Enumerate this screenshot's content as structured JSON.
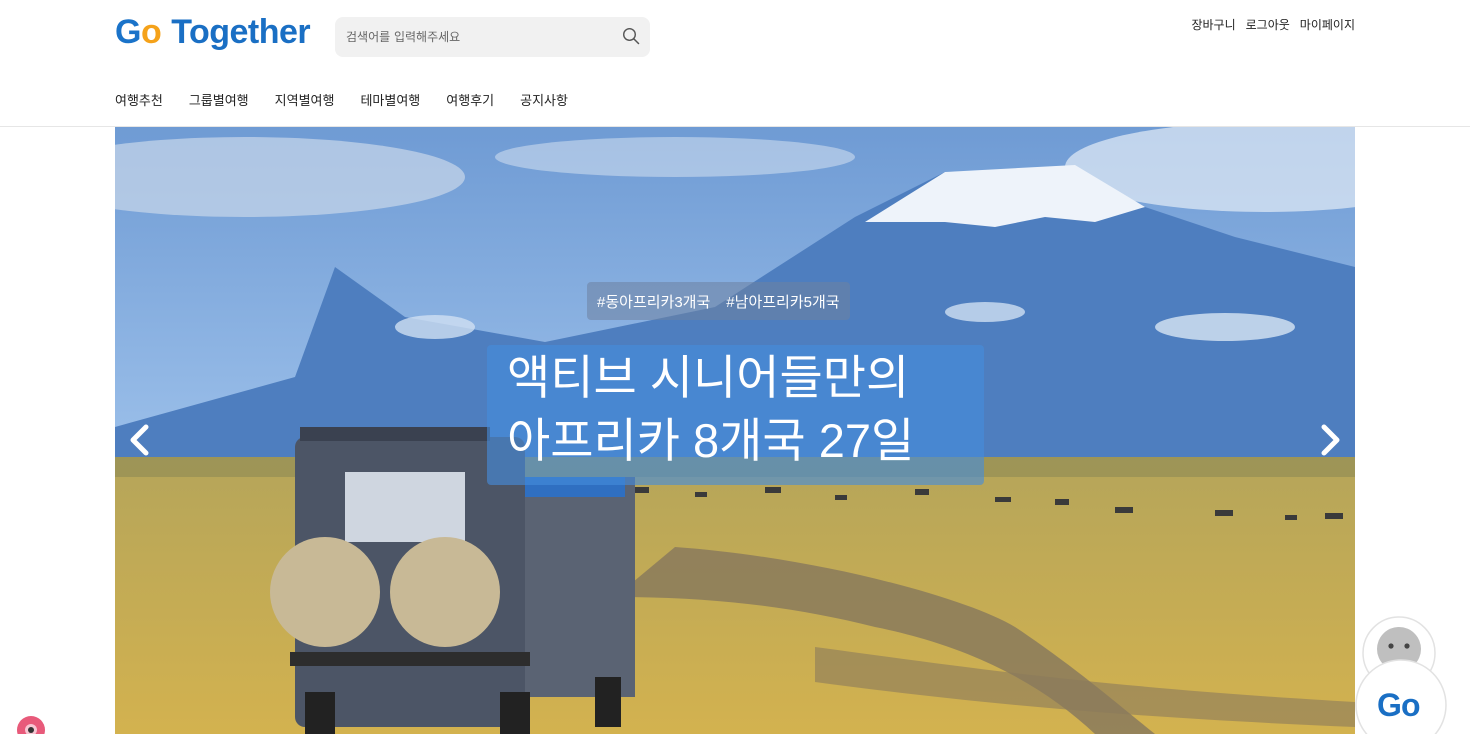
{
  "brand": {
    "logo_text_a": "G",
    "logo_text_b": "o",
    "logo_text_c": "Together",
    "color": "#1a6fc4",
    "accent": "#f5a21a"
  },
  "search": {
    "placeholder": "검색어를 입력해주세요",
    "icon": "search-icon"
  },
  "util": {
    "cart": "장바구니",
    "logout": "로그아웃",
    "mypage": "마이페이지"
  },
  "nav": [
    "여행추천",
    "그룹별여행",
    "지역별여행",
    "테마별여행",
    "여행후기",
    "공지사항"
  ],
  "hero": {
    "tags": [
      "#동아프리카3개국",
      "#남아프리카5개국"
    ],
    "headline_line1": "액티브 시니어들만의",
    "headline_line2": "아프리카 8개국 27일",
    "prev_icon": "chevron-left-icon",
    "next_icon": "chevron-right-icon"
  },
  "chatbot": {
    "label": "Go",
    "icon": "chatbot-icon"
  }
}
